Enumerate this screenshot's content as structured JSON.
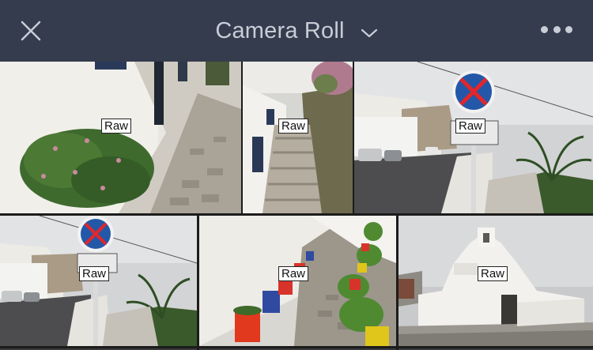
{
  "header": {
    "title": "Camera Roll",
    "close_icon": "close-icon",
    "dropdown_icon": "chevron-down-icon",
    "more_icon": "more-dots-icon",
    "background_color": "#353c4e",
    "text_color": "#c9cdd6"
  },
  "photos": [
    {
      "id": "p1",
      "badge": "Raw",
      "subject": "whitewashed wall with flowering bush and stone path"
    },
    {
      "id": "p2",
      "badge": "Raw",
      "subject": "narrow alley with stone steps"
    },
    {
      "id": "p3",
      "badge": "Raw",
      "subject": "street with no-stopping sign and palm tree"
    },
    {
      "id": "p4",
      "badge": "Raw",
      "subject": "street with no-stopping sign and palm tree"
    },
    {
      "id": "p5",
      "badge": "Raw",
      "subject": "white alley with colorful flower pots"
    },
    {
      "id": "p6",
      "badge": "Raw",
      "subject": "whitewashed church"
    }
  ]
}
